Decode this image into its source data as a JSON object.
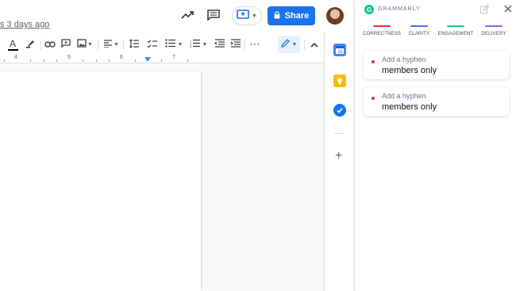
{
  "docs": {
    "last_edit": "s 3 days ago",
    "share_label": "Share"
  },
  "toolbar": {
    "text_color_letter": "A",
    "more": "⋯"
  },
  "ruler": {
    "labels": [
      "4",
      "5",
      "6",
      "7"
    ]
  },
  "side_panel": {
    "add_label": "+"
  },
  "grammarly": {
    "logo_letter": "G",
    "brand": "GRAMMARLY",
    "tabs": [
      {
        "label": "CORRECTNESS",
        "color": "#e6322d"
      },
      {
        "label": "CLARITY",
        "color": "#4a6ee0"
      },
      {
        "label": "ENGAGEMENT",
        "color": "#15c39a"
      },
      {
        "label": "DELIVERY",
        "color": "#9d5cd6"
      }
    ],
    "suggestions": [
      {
        "hint": "Add a hyphen",
        "text": "members only"
      },
      {
        "hint": "Add a hyphen",
        "text": "members only"
      }
    ]
  }
}
